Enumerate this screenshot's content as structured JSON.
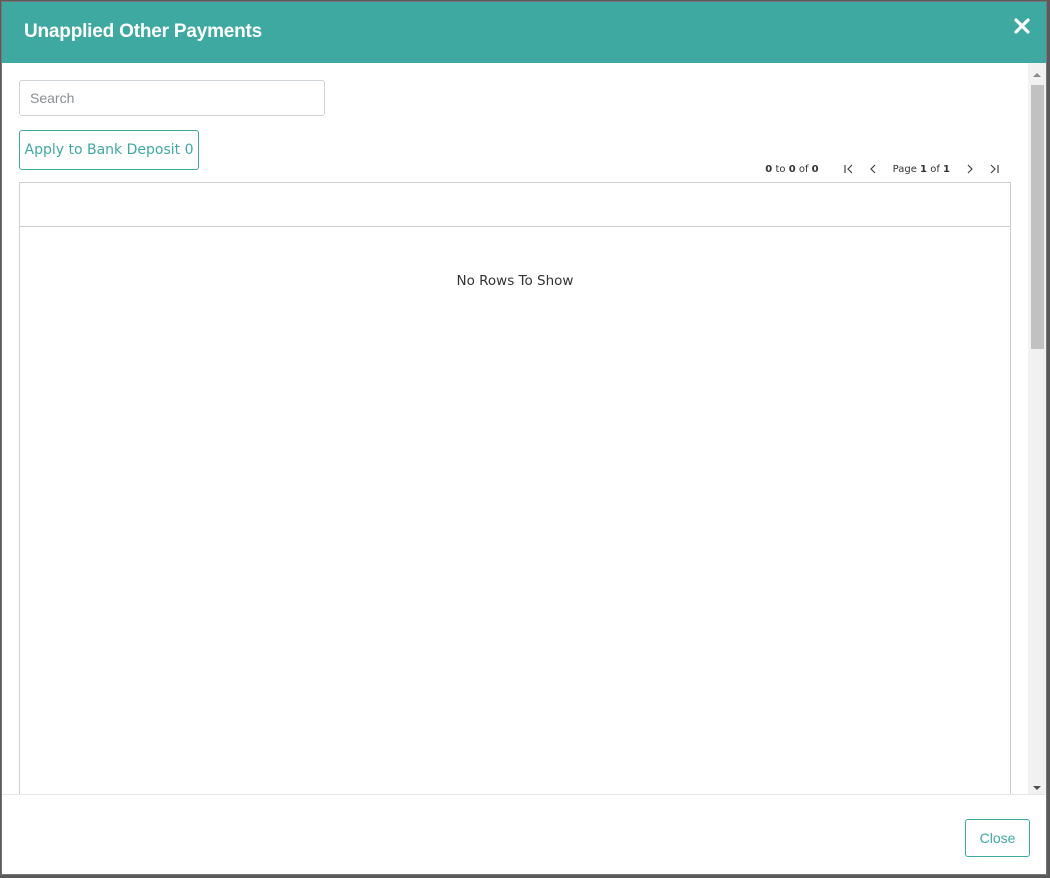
{
  "modal": {
    "title": "Unapplied Other Payments",
    "close_icon": "close-icon"
  },
  "search": {
    "placeholder": "Search",
    "value": ""
  },
  "toolbar": {
    "apply_label": "Apply to Bank Deposit 0"
  },
  "pager": {
    "from": "0",
    "to_word": "to",
    "to": "0",
    "of_word": "of",
    "total": "0",
    "page_word": "Page",
    "page": "1",
    "page_of_word": "of",
    "pages": "1",
    "icons": [
      "first-page-icon",
      "previous-page-icon",
      "next-page-icon",
      "last-page-icon"
    ]
  },
  "grid": {
    "columns": [],
    "rows": [],
    "empty_message": "No Rows To Show"
  },
  "footer": {
    "close_label": "Close"
  },
  "colors": {
    "accent": "#3ea9a1",
    "header_text": "#ffffff",
    "backdrop": "#5a5a5a"
  }
}
